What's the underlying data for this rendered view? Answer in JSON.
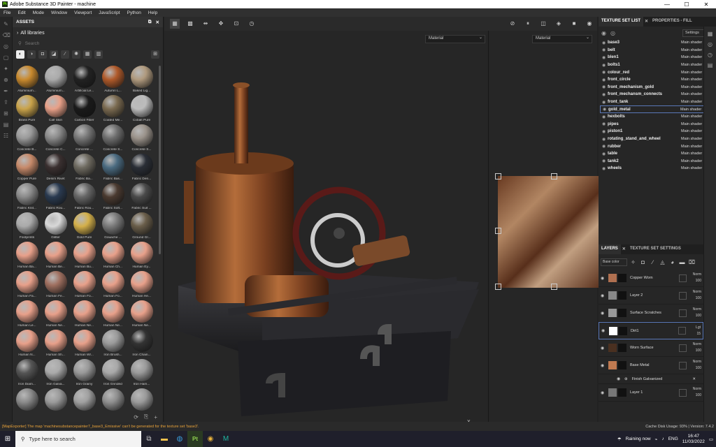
{
  "window": {
    "title": "Adobe Substance 3D Painter - machine",
    "app_icon": "Pt",
    "min": "—",
    "max": "☐",
    "close": "✕"
  },
  "menu": [
    "File",
    "Edit",
    "Mode",
    "Window",
    "Viewport",
    "JavaScript",
    "Python",
    "Help"
  ],
  "assets": {
    "title": "ASSETS",
    "library": "All libraries",
    "search_placeholder": "Search",
    "items": [
      {
        "label": "Aluminium...",
        "color": "#c98a2e"
      },
      {
        "label": "Aluminium...",
        "color": "#aaaaaa"
      },
      {
        "label": "Artificial Le...",
        "color": "#222222"
      },
      {
        "label": "Autumn L...",
        "color": "#b05a2a"
      },
      {
        "label": "Baked Lig...",
        "color": "#b09a7e"
      },
      {
        "label": "Brass Pure",
        "color": "#c9a34a"
      },
      {
        "label": "Calf Skin",
        "color": "#e8a088"
      },
      {
        "label": "Carbon Fiber",
        "color": "#1a1a1a"
      },
      {
        "label": "Coated Me...",
        "color": "#7a6a50"
      },
      {
        "label": "Cobalt Pure",
        "color": "#bcbcbc"
      },
      {
        "label": "Concrete B...",
        "color": "#9a9a9a"
      },
      {
        "label": "Concrete C...",
        "color": "#8a8a8a"
      },
      {
        "label": "Concrete ...",
        "color": "#777777"
      },
      {
        "label": "Concrete S...",
        "color": "#6e6e6e"
      },
      {
        "label": "Concrete S...",
        "color": "#9a928a"
      },
      {
        "label": "Copper Pure",
        "color": "#c78a6a"
      },
      {
        "label": "Denim Rivet",
        "color": "#3a3030"
      },
      {
        "label": "Fabric Ba...",
        "color": "#6e6a60"
      },
      {
        "label": "Fabric Bas...",
        "color": "#4a6a80"
      },
      {
        "label": "Fabric Den...",
        "color": "#2a2e36"
      },
      {
        "label": "Fabric Knit...",
        "color": "#8a8a8a"
      },
      {
        "label": "Fabric Rou...",
        "color": "#2a3a50"
      },
      {
        "label": "Fabric Rou...",
        "color": "#666666"
      },
      {
        "label": "Fabric Soft...",
        "color": "#4a3a30"
      },
      {
        "label": "Fabric Suit ...",
        "color": "#4a4a4a"
      },
      {
        "label": "Footprints",
        "color": "#aaaaaa"
      },
      {
        "label": "Glitter",
        "color": "#d8d8d8"
      },
      {
        "label": "Gold Pure",
        "color": "#d4b04a"
      },
      {
        "label": "Gouache ...",
        "color": "#7a7a7a"
      },
      {
        "label": "Ground Gr...",
        "color": "#6a5e4a"
      },
      {
        "label": "Human Ba...",
        "color": "#e8a08a"
      },
      {
        "label": "Human Be...",
        "color": "#e8a08a"
      },
      {
        "label": "Human Bu...",
        "color": "#e8a08a"
      },
      {
        "label": "Human Ch...",
        "color": "#e8a08a"
      },
      {
        "label": "Human Ey...",
        "color": "#e8a08a"
      },
      {
        "label": "Human Fa...",
        "color": "#e8a08a"
      },
      {
        "label": "Human Fe...",
        "color": "#a07060"
      },
      {
        "label": "Human Fo...",
        "color": "#e8a08a"
      },
      {
        "label": "Human Fo...",
        "color": "#e8a08a"
      },
      {
        "label": "Human He...",
        "color": "#e8a08a"
      },
      {
        "label": "Human Le...",
        "color": "#e8a08a"
      },
      {
        "label": "Human Ne...",
        "color": "#e8a08a"
      },
      {
        "label": "Human Ne...",
        "color": "#e8a08a"
      },
      {
        "label": "Human Ne...",
        "color": "#e8a08a"
      },
      {
        "label": "Human Ne...",
        "color": "#e8a08a"
      },
      {
        "label": "Human N...",
        "color": "#e8a08a"
      },
      {
        "label": "Human Sh...",
        "color": "#e8a08a"
      },
      {
        "label": "Human Wr...",
        "color": "#e8a08a"
      },
      {
        "label": "Iron Brush...",
        "color": "#9a9a9a"
      },
      {
        "label": "Iron Chain...",
        "color": "#333333"
      },
      {
        "label": "Iron Diam...",
        "color": "#555555"
      },
      {
        "label": "Iron Galva...",
        "color": "#aaaaaa"
      },
      {
        "label": "Iron Grainy",
        "color": "#999999"
      },
      {
        "label": "Iron Grinded",
        "color": "#a8a8a8"
      },
      {
        "label": "Iron Ham...",
        "color": "#9a9a9a"
      },
      {
        "label": "",
        "color": "#8a8a8a"
      },
      {
        "label": "",
        "color": "#9a9a9a"
      },
      {
        "label": "",
        "color": "#a0a0a0"
      },
      {
        "label": "",
        "color": "#8e8e8e"
      },
      {
        "label": "",
        "color": "#9a9a9a"
      }
    ]
  },
  "viewport": {
    "left_dropdown": "Material",
    "right_dropdown": "Material"
  },
  "texture_set": {
    "tab1": "TEXTURE SET LIST",
    "tab2": "PROPERTIES - FILL",
    "settings": "Settings",
    "rows": [
      {
        "name": "base3",
        "shader": "Main shader"
      },
      {
        "name": "belt",
        "shader": "Main shader"
      },
      {
        "name": "blen1",
        "shader": "Main shader"
      },
      {
        "name": "bolts1",
        "shader": "Main shader"
      },
      {
        "name": "colour_red",
        "shader": "Main shader"
      },
      {
        "name": "front_circle",
        "shader": "Main shader"
      },
      {
        "name": "front_mechanism_gold",
        "shader": "Main shader"
      },
      {
        "name": "front_mechansm_connects",
        "shader": "Main shader"
      },
      {
        "name": "front_tank",
        "shader": "Main shader"
      },
      {
        "name": "gold_metal",
        "shader": "Main shader"
      },
      {
        "name": "hexbolts",
        "shader": "Main shader"
      },
      {
        "name": "pipes",
        "shader": "Main shader"
      },
      {
        "name": "piston1",
        "shader": "Main shader"
      },
      {
        "name": "rotating_stand_and_wheel",
        "shader": "Main shader"
      },
      {
        "name": "rubber",
        "shader": "Main shader"
      },
      {
        "name": "table",
        "shader": "Main shader"
      },
      {
        "name": "tank2",
        "shader": "Main shader"
      },
      {
        "name": "wheels",
        "shader": "Main shader"
      }
    ]
  },
  "layers": {
    "tab1": "LAYERS",
    "tab2": "TEXTURE SET SETTINGS",
    "blend_mode": "Base color",
    "items": [
      {
        "name": "Copper Worn",
        "blend": "Norm",
        "opacity": "100",
        "thumb": "#b07050"
      },
      {
        "name": "Layer 2",
        "blend": "Norm",
        "opacity": "100",
        "thumb": "#888888"
      },
      {
        "name": "Surface Scratches",
        "blend": "Norm",
        "opacity": "100",
        "thumb": "#999999"
      },
      {
        "name": "Dirt1",
        "blend": "Lgt",
        "opacity": "15",
        "thumb": "#ffffff"
      },
      {
        "name": "Worn Surface",
        "blend": "Norm",
        "opacity": "100",
        "thumb": "#4a3020"
      },
      {
        "name": "Base Metal",
        "blend": "Norm",
        "opacity": "100",
        "thumb": "#c07a50"
      },
      {
        "name": "Layer 1",
        "blend": "Norm",
        "opacity": "100",
        "thumb": "#777777"
      }
    ],
    "effect": "Finish Galvanized"
  },
  "status": {
    "error": "[MapExporter] The map 'machinesubstancepainter7_base3_Emissive' can't be generated for the texture set 'base3'.",
    "info": "Cache Disk Usage:  93% | Version: 7.4.2"
  },
  "taskbar": {
    "search": "Type here to search",
    "weather": "Raining now",
    "lang": "ENG",
    "time": "16:47",
    "date": "11/03/2022"
  }
}
